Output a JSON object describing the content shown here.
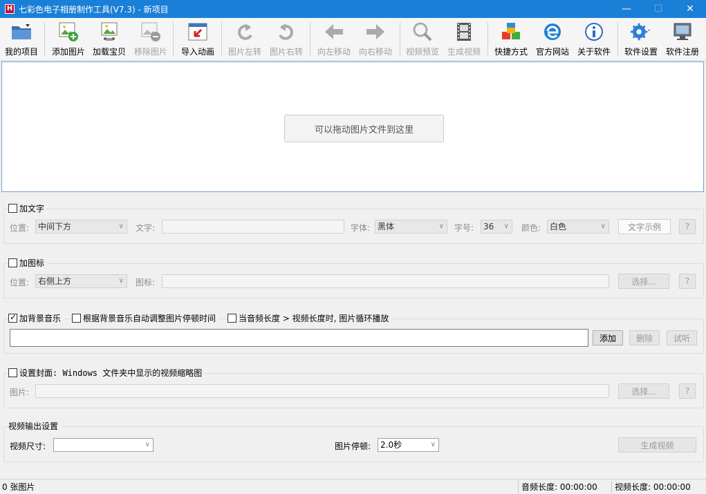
{
  "window": {
    "title": "七彩色电子相册制作工具(V7.3) - 新项目",
    "app_icon_letter": "H",
    "min_glyph": "—",
    "max_glyph": "☐",
    "close_glyph": "✕"
  },
  "toolbar": {
    "items": [
      {
        "label": "我的项目",
        "icon": "folder-icon",
        "enabled": true
      },
      {
        "label": "添加图片",
        "icon": "add-image-icon",
        "enabled": true
      },
      {
        "label": "加载宝贝",
        "icon": "load-item-icon",
        "enabled": true
      },
      {
        "label": "移除图片",
        "icon": "remove-image-icon",
        "enabled": false
      },
      {
        "label": "导入动画",
        "icon": "import-animation-icon",
        "enabled": true
      },
      {
        "label": "图片左转",
        "icon": "rotate-left-icon",
        "enabled": false
      },
      {
        "label": "图片右转",
        "icon": "rotate-right-icon",
        "enabled": false
      },
      {
        "label": "向左移动",
        "icon": "arrow-left-icon",
        "enabled": false
      },
      {
        "label": "向右移动",
        "icon": "arrow-right-icon",
        "enabled": false
      },
      {
        "label": "视频预览",
        "icon": "magnifier-icon",
        "enabled": false
      },
      {
        "label": "生成视频",
        "icon": "film-icon",
        "enabled": false
      },
      {
        "label": "快捷方式",
        "icon": "cubes-icon",
        "enabled": true
      },
      {
        "label": "官方网站",
        "icon": "ie-icon",
        "enabled": true
      },
      {
        "label": "关于软件",
        "icon": "info-icon",
        "enabled": true
      },
      {
        "label": "软件设置",
        "icon": "gear-icon",
        "enabled": true
      },
      {
        "label": "软件注册",
        "icon": "monitor-icon",
        "enabled": true
      }
    ]
  },
  "dropzone": {
    "hint": "可以拖动图片文件到这里"
  },
  "text_group": {
    "checkbox_label": "加文字",
    "checked": false,
    "position_label": "位置:",
    "position_value": "中间下方",
    "text_label": "文字:",
    "text_value": "",
    "font_label": "字体:",
    "font_value": "黑体",
    "size_label": "字号:",
    "size_value": "36",
    "color_label": "颜色:",
    "color_value": "白色",
    "sample_button": "文字示例",
    "help_button": "?"
  },
  "logo_group": {
    "checkbox_label": "加图标",
    "checked": false,
    "position_label": "位置:",
    "position_value": "右侧上方",
    "icon_label": "图标:",
    "icon_value": "",
    "choose_button": "选择...",
    "help_button": "?"
  },
  "music_group": {
    "checkbox_label": "加背景音乐",
    "checked": true,
    "auto_adjust_label": "根据背景音乐自动调整图片停顿时间",
    "auto_adjust_checked": false,
    "loop_label": "当音频长度 > 视频长度时, 图片循环播放",
    "loop_checked": false,
    "file_value": "",
    "add_button": "添加",
    "delete_button": "删除",
    "listen_button": "试听"
  },
  "cover_group": {
    "checkbox_label": "设置封面: Windows 文件夹中显示的视频缩略图",
    "checked": false,
    "image_label": "图片:",
    "image_value": "",
    "choose_button": "选择...",
    "help_button": "?"
  },
  "output_group": {
    "title": "视频输出设置",
    "size_label": "视频尺寸:",
    "size_value": "",
    "pause_label": "图片停顿:",
    "pause_value": "2.0秒",
    "generate_button": "生成视频"
  },
  "status": {
    "image_count": "0 张图片",
    "audio_length": "音频长度: 00:00:00",
    "video_length": "视频长度: 00:00:00"
  }
}
